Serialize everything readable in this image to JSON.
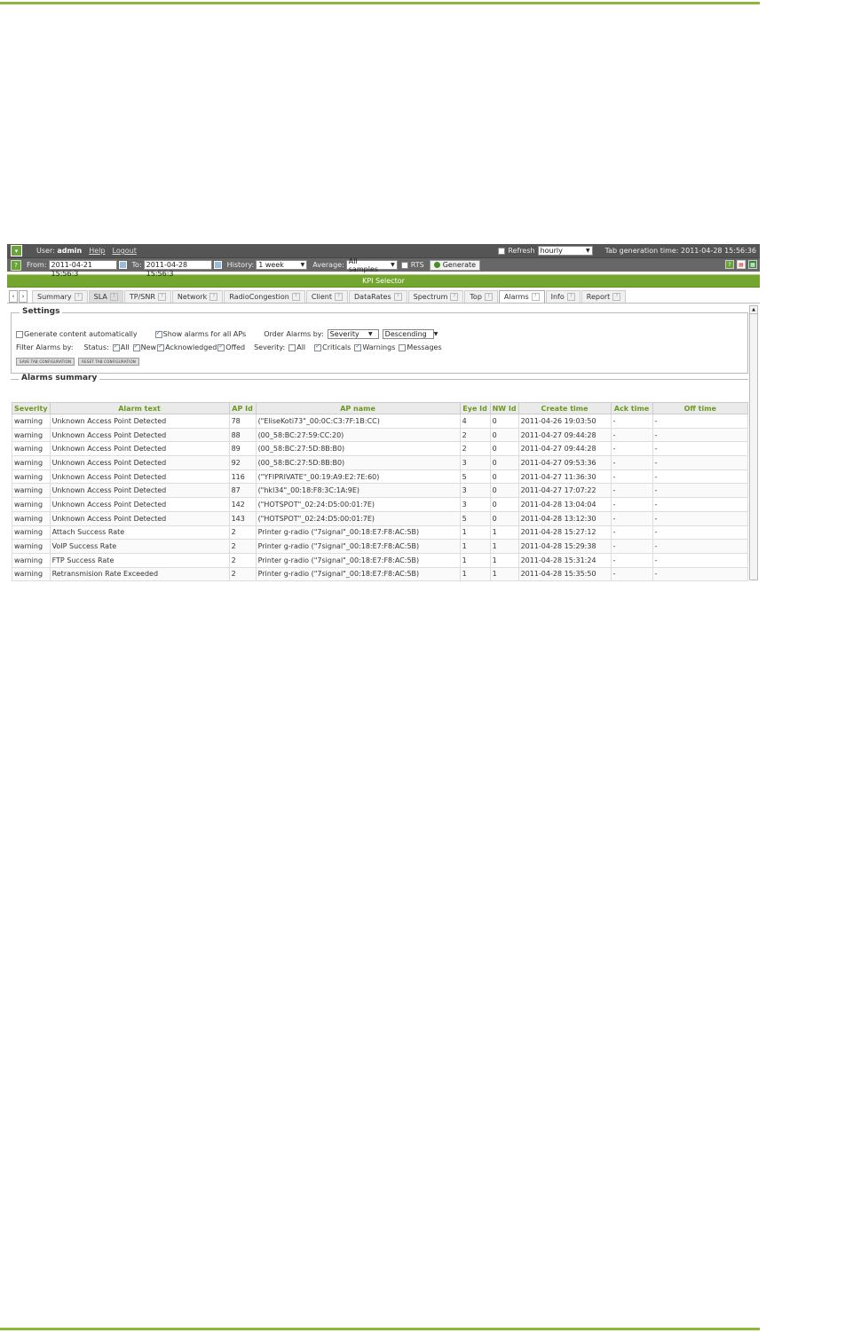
{
  "topbar": {
    "user_label": "User:",
    "user_name": "admin",
    "help": "Help",
    "logout": "Logout",
    "refresh_label": "Refresh",
    "refresh_value": "hourly",
    "tab_generation": "Tab generation time: 2011-04-28 15:56:36"
  },
  "toolbar": {
    "from_label": "From:",
    "from_value": "2011-04-21 15:56:3",
    "to_label": "To:",
    "to_value": "2011-04-28 15:56:3",
    "history_label": "History:",
    "history_value": "1 week",
    "average_label": "Average:",
    "average_value": "All samples",
    "rts_label": "RTS",
    "generate_label": "Generate"
  },
  "kpi_title": "KPI Selector",
  "tabs": [
    {
      "label": "Summary"
    },
    {
      "label": "SLA"
    },
    {
      "label": "TP/SNR"
    },
    {
      "label": "Network"
    },
    {
      "label": "RadioCongestion"
    },
    {
      "label": "Client"
    },
    {
      "label": "DataRates"
    },
    {
      "label": "Spectrum"
    },
    {
      "label": "Top"
    },
    {
      "label": "Alarms"
    },
    {
      "label": "Info"
    },
    {
      "label": "Report"
    }
  ],
  "settings": {
    "legend": "Settings",
    "generate_auto": "Generate content automatically",
    "show_all_aps": "Show alarms for all APs",
    "order_label": "Order Alarms by:",
    "order_value": "Severity",
    "order_dir": "Descending",
    "filter_label": "Filter Alarms by:",
    "status_label": "Status:",
    "status_all": "All",
    "status_new": "New",
    "status_ack": "Acknowledged",
    "status_offed": "Offed",
    "severity_label": "Severity:",
    "sev_all": "All",
    "sev_criticals": "Criticals",
    "sev_warnings": "Warnings",
    "sev_messages": "Messages",
    "save_btn": "SAVE TAB CONFIGURATION",
    "reset_btn": "RESET TAB CONFIGURATION"
  },
  "alarms": {
    "legend": "Alarms summary",
    "columns": [
      "Severity",
      "Alarm text",
      "AP Id",
      "AP name",
      "Eye Id",
      "NW Id",
      "Create time",
      "Ack time",
      "Off time"
    ],
    "rows": [
      [
        "warning",
        "Unknown Access Point Detected",
        "78",
        "(\"EliseKoti73\"_00:0C:C3:7F:1B:CC)",
        "4",
        "0",
        "2011-04-26 19:03:50",
        "-",
        "-"
      ],
      [
        "warning",
        "Unknown Access Point Detected",
        "88",
        "(00_58:BC:27:59:CC:20)",
        "2",
        "0",
        "2011-04-27 09:44:28",
        "-",
        "-"
      ],
      [
        "warning",
        "Unknown Access Point Detected",
        "89",
        "(00_58:BC:27:5D:8B:B0)",
        "2",
        "0",
        "2011-04-27 09:44:28",
        "-",
        "-"
      ],
      [
        "warning",
        "Unknown Access Point Detected",
        "92",
        "(00_58:BC:27:5D:8B:B0)",
        "3",
        "0",
        "2011-04-27 09:53:36",
        "-",
        "-"
      ],
      [
        "warning",
        "Unknown Access Point Detected",
        "116",
        "(\"YFIPRIVATE\"_00:19:A9:E2:7E:60)",
        "5",
        "0",
        "2011-04-27 11:36:30",
        "-",
        "-"
      ],
      [
        "warning",
        "Unknown Access Point Detected",
        "87",
        "(\"hkl34\"_00:18:F8:3C:1A:9E)",
        "3",
        "0",
        "2011-04-27 17:07:22",
        "-",
        "-"
      ],
      [
        "warning",
        "Unknown Access Point Detected",
        "142",
        "(\"HOTSPOT\"_02:24:D5:00:01:7E)",
        "3",
        "0",
        "2011-04-28 13:04:04",
        "-",
        "-"
      ],
      [
        "warning",
        "Unknown Access Point Detected",
        "143",
        "(\"HOTSPOT\"_02:24:D5:00:01:7E)",
        "5",
        "0",
        "2011-04-28 13:12:30",
        "-",
        "-"
      ],
      [
        "warning",
        "Attach Success Rate",
        "2",
        "Printer g-radio (\"7signal\"_00:18:E7:F8:AC:5B)",
        "1",
        "1",
        "2011-04-28 15:27:12",
        "-",
        "-"
      ],
      [
        "warning",
        "VoIP Success Rate",
        "2",
        "Printer g-radio (\"7signal\"_00:18:E7:F8:AC:5B)",
        "1",
        "1",
        "2011-04-28 15:29:38",
        "-",
        "-"
      ],
      [
        "warning",
        "FTP Success Rate",
        "2",
        "Printer g-radio (\"7signal\"_00:18:E7:F8:AC:5B)",
        "1",
        "1",
        "2011-04-28 15:31:24",
        "-",
        "-"
      ],
      [
        "warning",
        "Retransmision Rate Exceeded",
        "2",
        "Printer g-radio (\"7signal\"_00:18:E7:F8:AC:5B)",
        "1",
        "1",
        "2011-04-28 15:35:50",
        "-",
        "-"
      ]
    ]
  },
  "colors": {
    "accent": "#73a52f",
    "header_text": "#6b9a1e",
    "topbar": "#555555"
  }
}
